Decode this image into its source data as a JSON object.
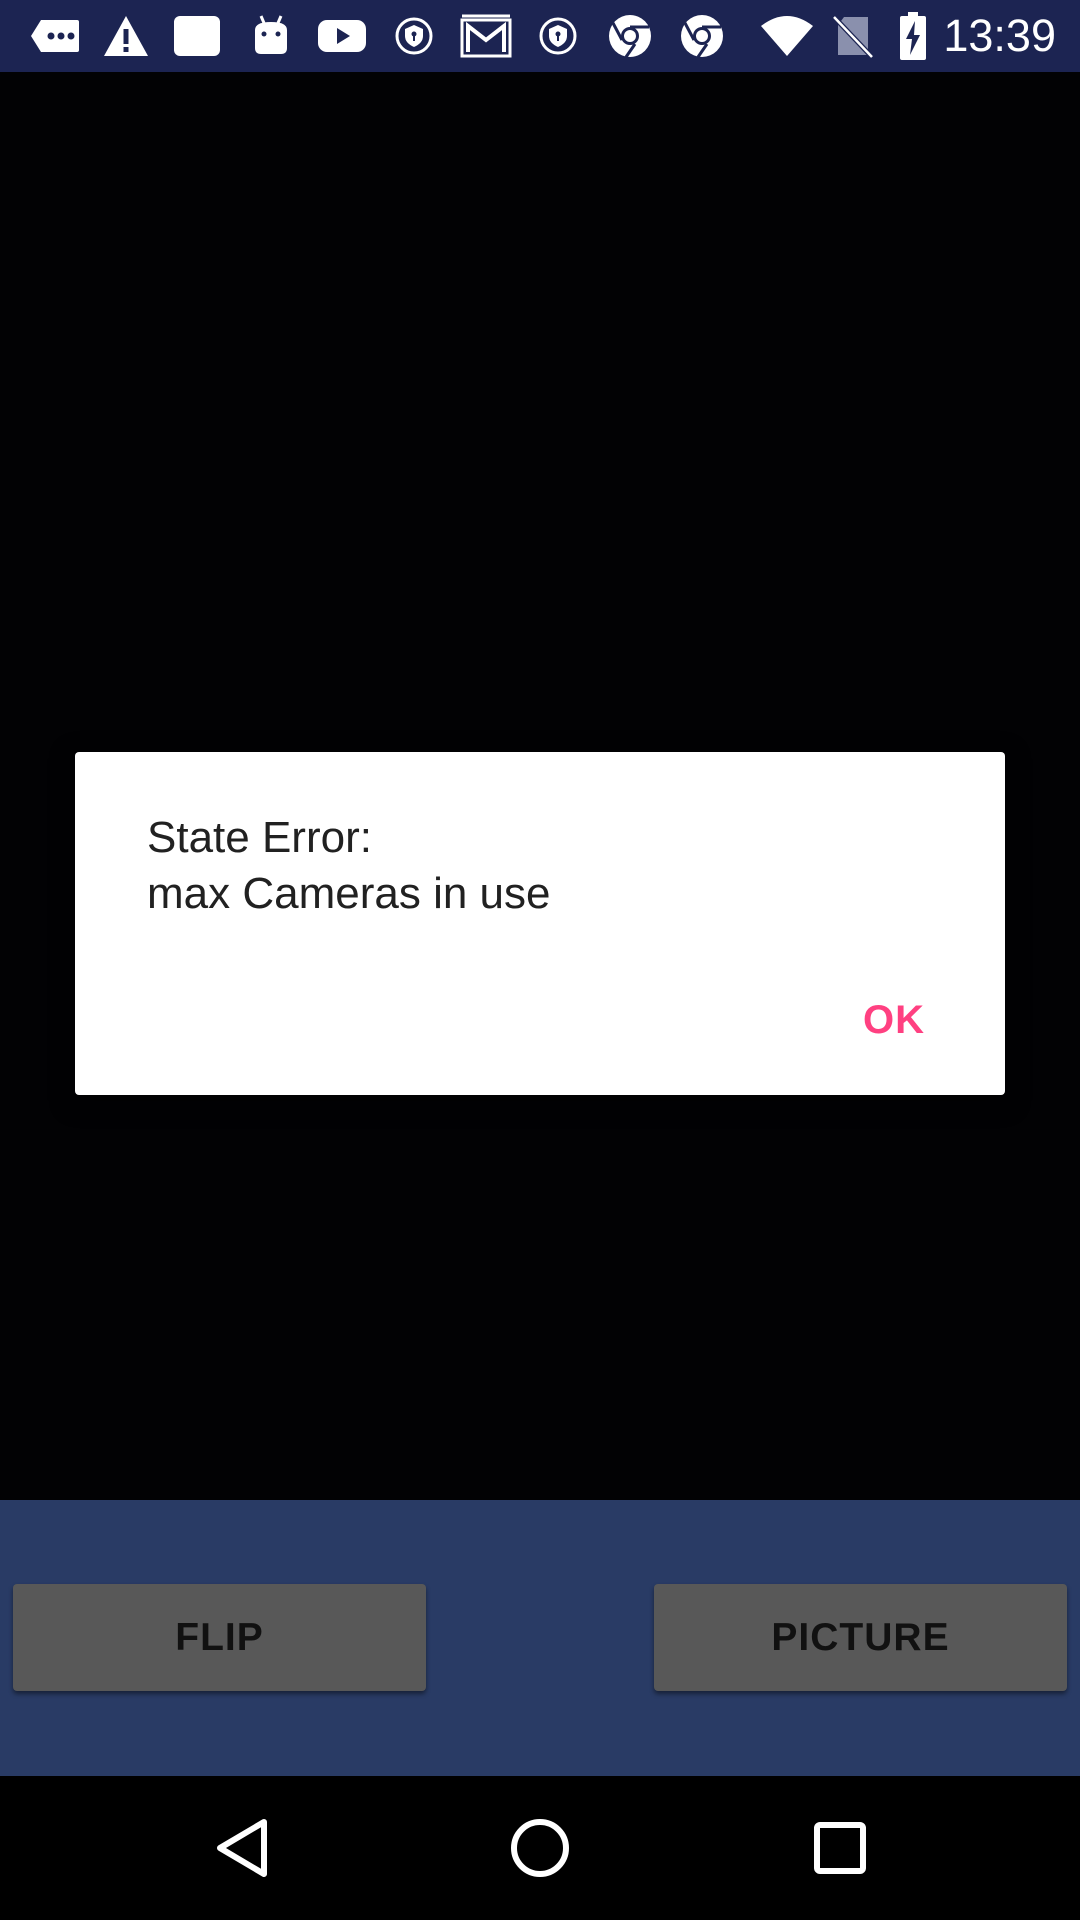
{
  "status_bar": {
    "time": "13:39",
    "notification_icons": [
      "message-icon",
      "warning-icon",
      "app-icon",
      "android-icon",
      "youtube-icon",
      "vpn-key-icon",
      "gmail-icon",
      "vpn-key-icon",
      "chrome-icon",
      "chrome-icon"
    ],
    "system_icons": [
      "wifi-icon",
      "no-sim-icon",
      "battery-charging-icon"
    ]
  },
  "dialog": {
    "message": "State Error:\nmax Cameras in use",
    "ok_label": "OK",
    "accent_color": "#ff4081"
  },
  "controls": {
    "flip_label": "FLIP",
    "picture_label": "PICTURE"
  },
  "nav_bar": {
    "back": "back-icon",
    "home": "home-icon",
    "recents": "recents-icon"
  },
  "colors": {
    "status_bar": "#1c2452",
    "control_bar": "#293b65",
    "button": "#585858"
  }
}
